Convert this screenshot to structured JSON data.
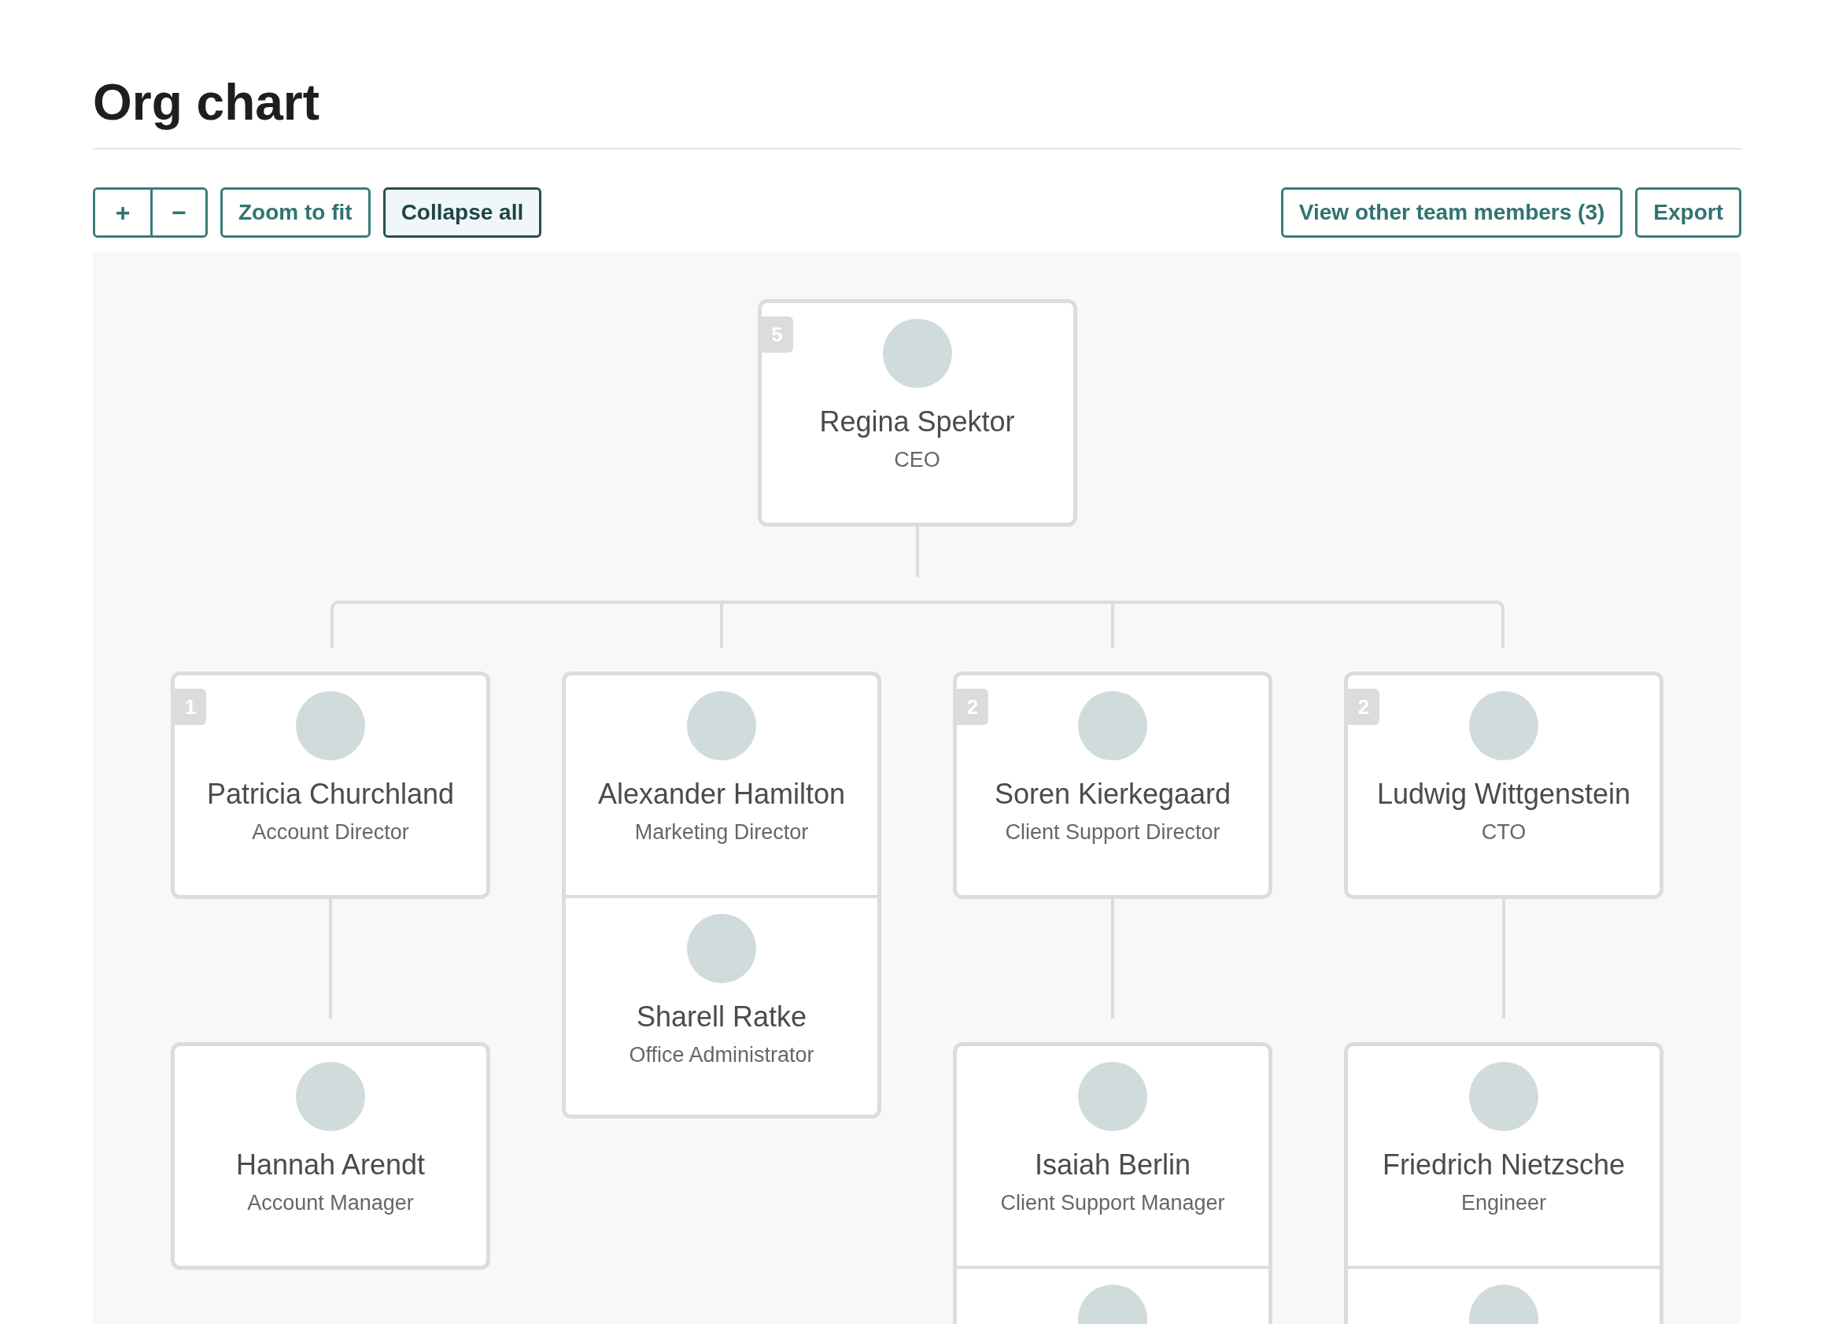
{
  "title": "Org chart",
  "toolbar": {
    "zoom_buttons": [
      "+",
      "−"
    ],
    "buttons": [
      {
        "label": "Zoom to fit",
        "selected": false
      },
      {
        "label": "Collapse all",
        "selected": true
      }
    ],
    "right_buttons": [
      "View other team members (3)",
      "Export"
    ]
  },
  "chart": {
    "count": "5",
    "members": [
      {
        "kind": "person",
        "name": "Regina Spektor",
        "role": "CEO"
      }
    ],
    "children": [
      {
        "count": "1",
        "members": [
          {
            "kind": "person",
            "name": "Patricia Churchland",
            "role": "Account Director"
          }
        ],
        "children": [
          {
            "members": [
              {
                "kind": "person",
                "name": "Hannah Arendt",
                "role": "Account Manager"
              }
            ]
          }
        ]
      },
      {
        "members": [
          {
            "kind": "person",
            "name": "Alexander Hamilton",
            "role": "Marketing Director"
          },
          {
            "kind": "person",
            "name": "Sharell Ratke",
            "role": "Office Administrator"
          }
        ]
      },
      {
        "count": "2",
        "members": [
          {
            "kind": "person",
            "name": "Soren Kierkegaard",
            "role": "Client Support Director"
          }
        ],
        "children": [
          {
            "members": [
              {
                "kind": "person",
                "name": "Isaiah Berlin",
                "role": "Client Support Manager"
              },
              {
                "kind": "partial"
              }
            ]
          }
        ]
      },
      {
        "count": "2",
        "members": [
          {
            "kind": "person",
            "name": "Ludwig Wittgenstein",
            "role": "CTO"
          }
        ],
        "children": [
          {
            "members": [
              {
                "kind": "person",
                "name": "Friedrich Nietzsche",
                "role": "Engineer"
              },
              {
                "kind": "partial"
              }
            ]
          }
        ]
      }
    ]
  }
}
